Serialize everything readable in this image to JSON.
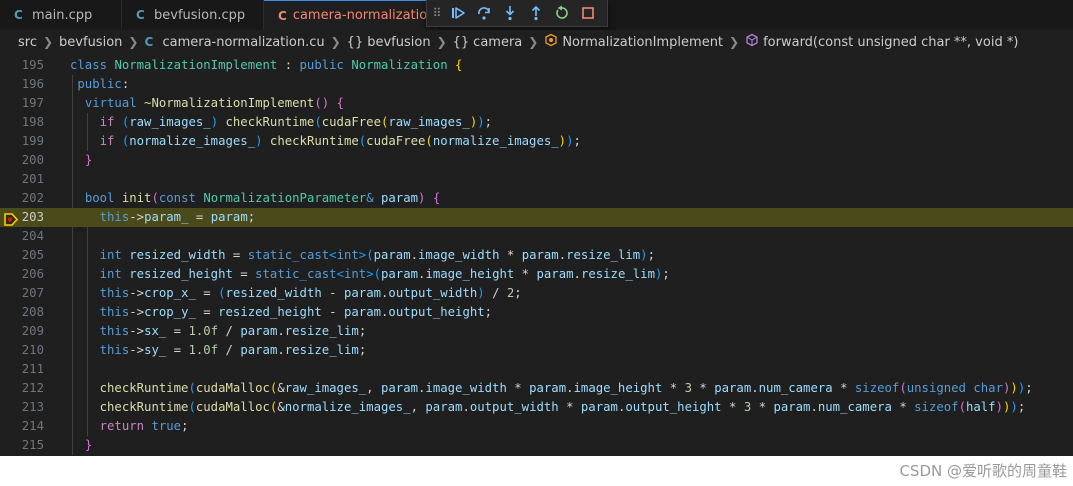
{
  "tabs": [
    {
      "label": "main.cpp",
      "icon": "c-file-icon",
      "active": false
    },
    {
      "label": "bevfusion.cpp",
      "icon": "c-file-icon",
      "active": false
    },
    {
      "label": "camera-normalization.cu",
      "icon": "c-file-icon",
      "active": true
    }
  ],
  "debug_toolbar": [
    "drag-handle",
    "continue",
    "step-over",
    "step-into",
    "step-out",
    "restart",
    "stop"
  ],
  "breadcrumb": {
    "src": "src",
    "folder": "bevfusion",
    "file": "camera-normalization.cu",
    "ns1": "bevfusion",
    "ns2": "camera",
    "class": "NormalizationImplement",
    "method": "forward(const unsigned char **, void *)"
  },
  "code": {
    "current_line": "203",
    "breakpoint_line": "203",
    "line_numbers": [
      "195",
      "196",
      "197",
      "198",
      "199",
      "200",
      "201",
      "202",
      "203",
      "204",
      "205",
      "206",
      "207",
      "208",
      "209",
      "210",
      "211",
      "212",
      "213",
      "214",
      "215"
    ]
  },
  "watermark": "CSDN @爱听歌的周童鞋",
  "colors": {
    "editor_bg": "#1f1f1f",
    "current_line_highlight": "#4b4a1b",
    "active_tab_text": "#f48771",
    "keyword": "#569cd6",
    "type": "#4ec9b0",
    "function": "#dcdcaa",
    "variable": "#9cdcfe",
    "number": "#b5cea8"
  }
}
